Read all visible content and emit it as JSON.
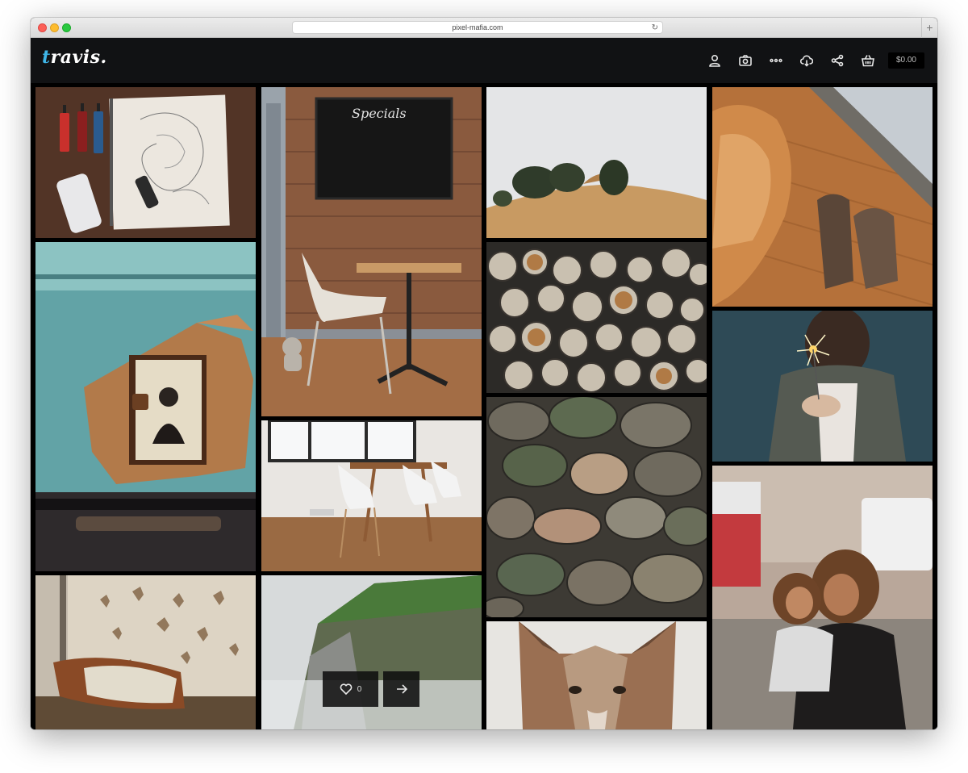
{
  "browser": {
    "url": "pixel-mafia.com",
    "new_tab_symbol": "+"
  },
  "brand": {
    "logo_first": "t",
    "logo_rest": "ravis.",
    "accent_color": "#3fb6e8"
  },
  "nav": {
    "icons": [
      "user-icon",
      "camera-icon",
      "more-icon",
      "cloud-download-icon",
      "share-icon",
      "basket-icon"
    ],
    "cart_total": "$0.00"
  },
  "gallery": {
    "photos": [
      "tattoo sketch with ink bottles and phone",
      "cafe corner with chalkboard reading Specials",
      "misty hill with trees",
      "cat and boots on wooden floor",
      "vintage photo on leather glove",
      "stacked firewood logs",
      "girl holding sparkler",
      "dining table with white chairs",
      "river stones",
      "leather wallet and butterfly collection",
      "misty cliffs",
      "mother and child on city street",
      "fox close-up"
    ],
    "likes_count": "0",
    "specials_text": "Specials"
  }
}
